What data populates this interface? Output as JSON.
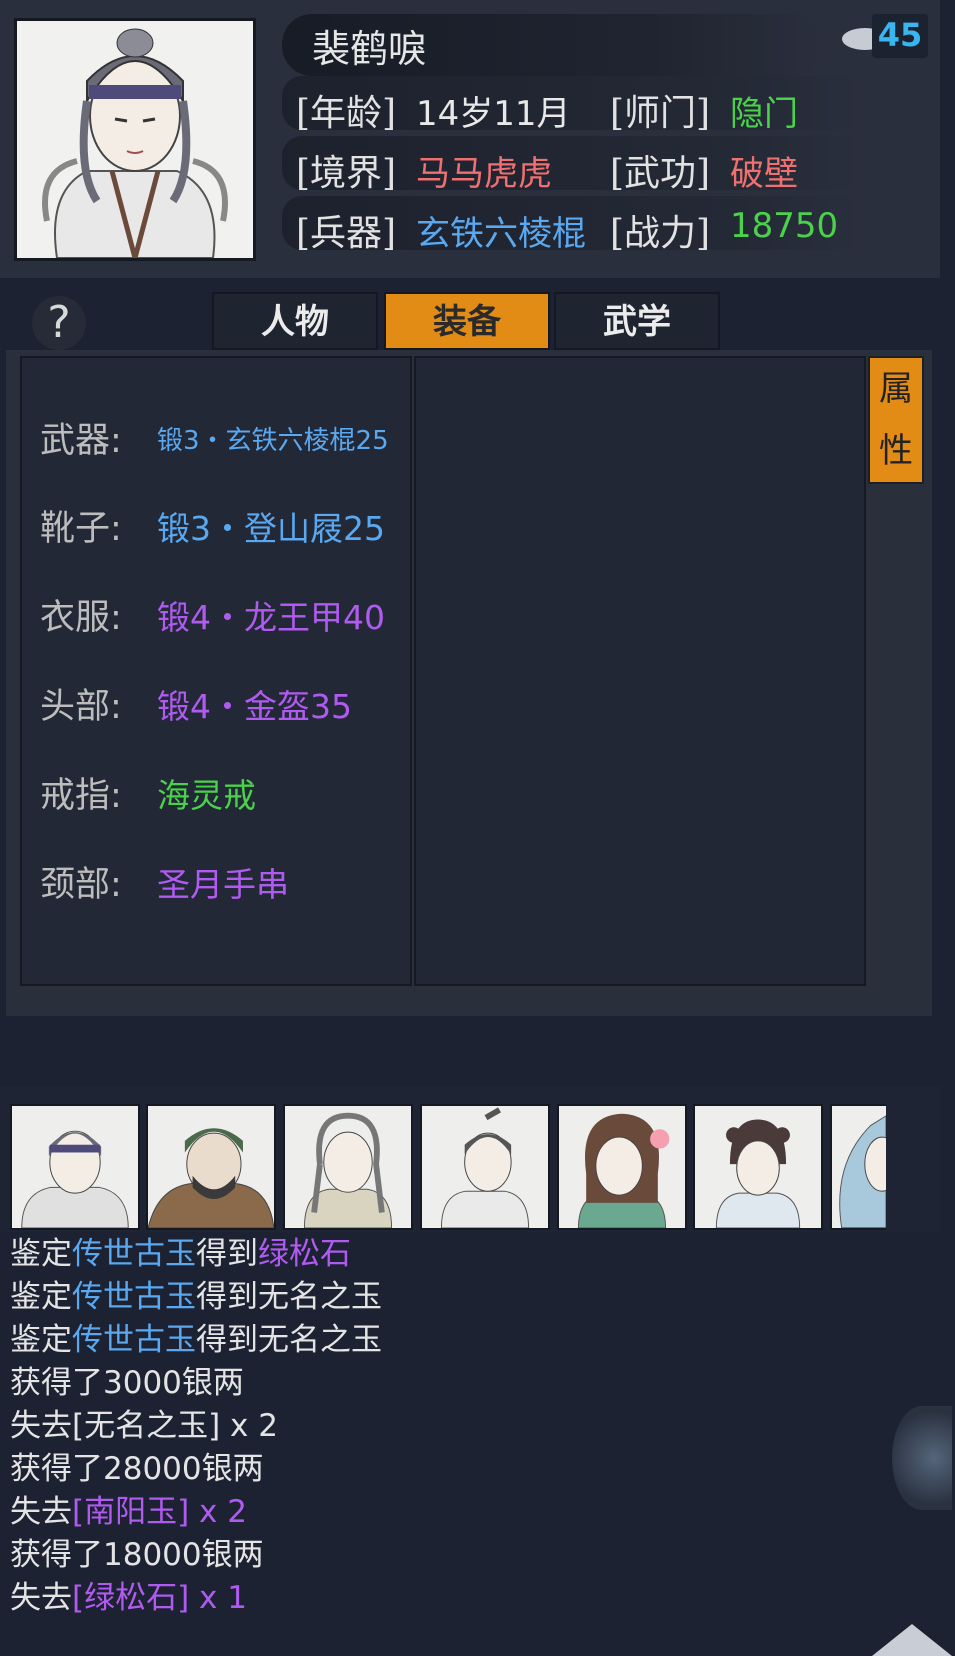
{
  "character": {
    "name": "裴鹤唳",
    "level": "45",
    "age_label": "[年龄]",
    "age": "14岁11月",
    "sect_label": "[师门]",
    "sect": "隐门",
    "realm_label": "[境界]",
    "realm": "马马虎虎",
    "martial_label": "[武功]",
    "martial": "破壁",
    "weapon_label": "[兵器]",
    "weapon": "玄铁六棱棍",
    "power_label": "[战力]",
    "power": "18750"
  },
  "help_label": "?",
  "tabs": [
    "人物",
    "装备",
    "武学"
  ],
  "active_tab": "装备",
  "attr_tab": [
    "属",
    "性"
  ],
  "equipment": [
    {
      "label": "武器:",
      "value": "锻3・玄铁六棱棍25",
      "color": "#5aa8f0"
    },
    {
      "label": "靴子:",
      "value": "锻3・登山屐25",
      "color": "#5aa8f0"
    },
    {
      "label": "衣服:",
      "value": "锻4・龙王甲40",
      "color": "#b05bf0"
    },
    {
      "label": "头部:",
      "value": "锻4・金盔35",
      "color": "#b05bf0"
    },
    {
      "label": "戒指:",
      "value": "海灵戒",
      "color": "#4ad24a"
    },
    {
      "label": "颈部:",
      "value": "圣月手串",
      "color": "#b05bf0"
    }
  ],
  "party_portraits": [
    "portrait-hero",
    "portrait-bearded-warrior",
    "portrait-long-haired-man",
    "portrait-young-swordsman",
    "portrait-lady-flower",
    "portrait-girl",
    "portrait-partial"
  ],
  "log": {
    "l1": {
      "a": "鉴定",
      "b": "传世古玉",
      "c": "得到",
      "d": "绿松石"
    },
    "l2": {
      "a": "鉴定",
      "b": "传世古玉",
      "c": "得到无名之玉"
    },
    "l3": {
      "a": "鉴定",
      "b": "传世古玉",
      "c": "得到无名之玉"
    },
    "l4": "获得了3000银两",
    "l5": "失去[无名之玉] x 2",
    "l6": "获得了28000银两",
    "l7": {
      "a": "失去",
      "b": "[南阳玉] x 2"
    },
    "l8": "获得了18000银两",
    "l9": {
      "a": "失去",
      "b": "[绿松石] x 1"
    }
  },
  "colors": {
    "accent": "#e38c15",
    "blue": "#5aa8f0",
    "purple": "#b05bf0",
    "green": "#4ad24a",
    "red": "#ef7070",
    "level": "#39b6f0"
  }
}
